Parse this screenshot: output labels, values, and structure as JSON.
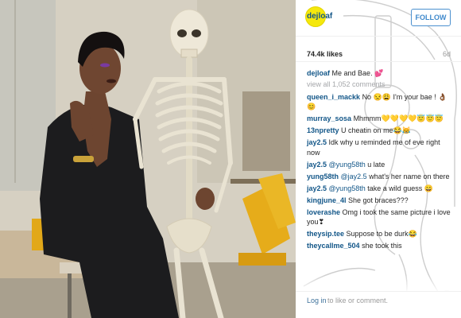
{
  "post": {
    "username": "dejloaf",
    "follow_label": "FOLLOW",
    "likes": "74.4k likes",
    "age": "6d",
    "caption_user": "dejloaf",
    "caption_text": "Me and Bae. 💕",
    "view_all": "view all 1,052 comments"
  },
  "comments": [
    {
      "user": "queen_i_mackk",
      "text": "No 😒😩 I'm your bae ! 👌🏾😊"
    },
    {
      "user": "murray_sosa",
      "text": "Mhmmm💛💛💛💛😇😇😇"
    },
    {
      "user": "13npretty",
      "text": "U cheatin on me😂😹"
    },
    {
      "user": "jay2.5",
      "text": "Idk why u reminded me of eve right now"
    },
    {
      "user": "jay2.5",
      "mention": "@yung58th",
      "text": "u late"
    },
    {
      "user": "yung58th",
      "mention": "@jay2.5",
      "text": "what's her name on there"
    },
    {
      "user": "jay2.5",
      "mention": "@yung58th",
      "text": "take a wild guess 😄"
    },
    {
      "user": "kingjune_4l",
      "text": "She got braces???"
    },
    {
      "user": "loverashe",
      "text": "Omg i took the same picture i love you❣"
    },
    {
      "user": "theysip.tee",
      "text": "Suppose to be durk😂"
    },
    {
      "user": "theycallme_504",
      "text": "she took this"
    }
  ],
  "footer": {
    "login_label": "Log in",
    "rest_text": "to like or comment."
  },
  "icons": {
    "avatar": "avatar",
    "more": "ellipsis-icon"
  },
  "colors": {
    "username_blue": "#125688",
    "follow_blue": "#3f89cc",
    "avatar_yellow": "#f5e80c"
  }
}
